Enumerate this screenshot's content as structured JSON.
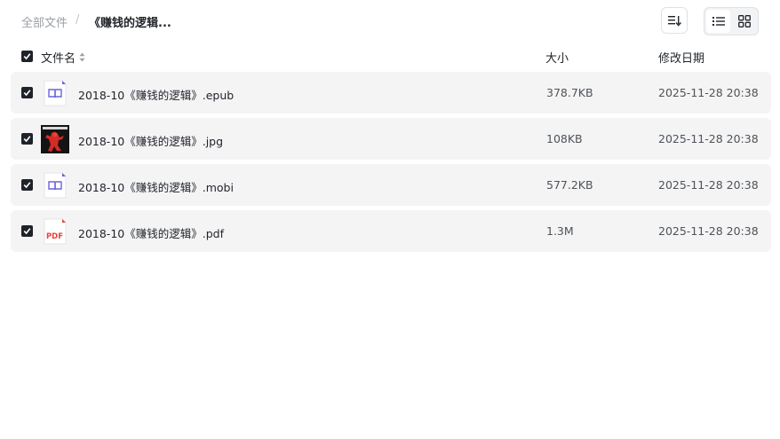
{
  "breadcrumb": {
    "root": "全部文件",
    "separator": "/",
    "current": "《赚钱的逻辑..."
  },
  "toolbar": {
    "sort_icon": "sort-icon",
    "view_list_icon": "list-view-icon",
    "view_grid_icon": "grid-view-icon",
    "active_view": "list"
  },
  "columns": {
    "name": "文件名",
    "size": "大小",
    "modified": "修改日期"
  },
  "files": [
    {
      "name": "2018-10《赚钱的逻辑》.epub",
      "size": "378.7KB",
      "modified": "2025-11-28 20:38",
      "icon": "ebook-icon",
      "checked": true
    },
    {
      "name": "2018-10《赚钱的逻辑》.jpg",
      "size": "108KB",
      "modified": "2025-11-28 20:38",
      "icon": "image-thumbnail",
      "checked": true
    },
    {
      "name": "2018-10《赚钱的逻辑》.mobi",
      "size": "577.2KB",
      "modified": "2025-11-28 20:38",
      "icon": "ebook-icon",
      "checked": true
    },
    {
      "name": "2018-10《赚钱的逻辑》.pdf",
      "size": "1.3M",
      "modified": "2025-11-28 20:38",
      "icon": "pdf-icon",
      "checked": true
    }
  ],
  "pdf_badge": "PDF",
  "colors": {
    "row_bg": "#f4f4f5",
    "checkbox": "#1f2329",
    "ebook_accent": "#6b63d9",
    "pdf_accent": "#e8443a"
  }
}
